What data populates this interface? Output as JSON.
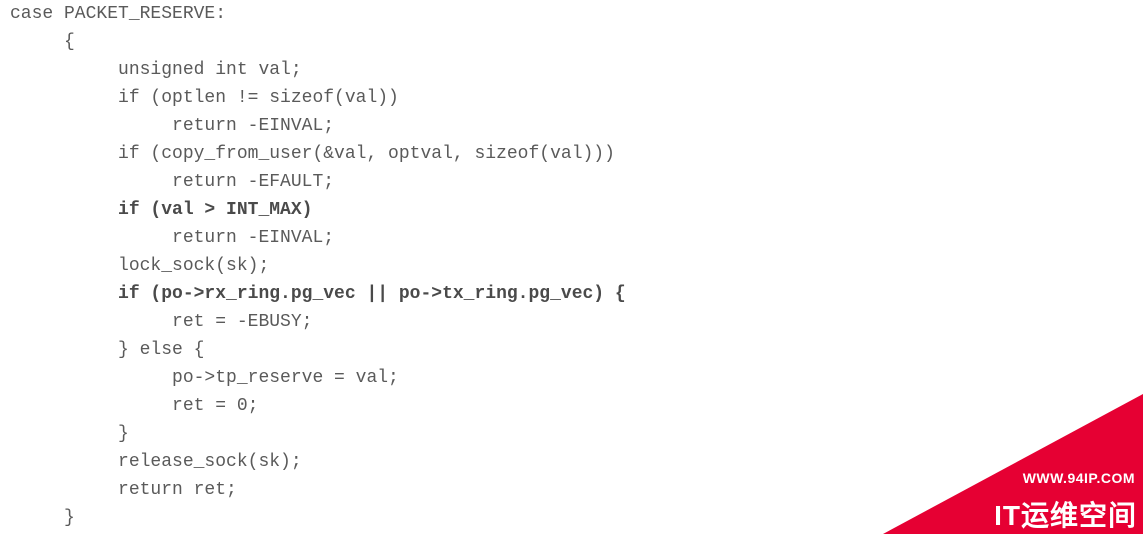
{
  "code": {
    "lines": [
      {
        "indent": 0,
        "text": "case PACKET_RESERVE:",
        "bold": false
      },
      {
        "indent": 1,
        "text": "{",
        "bold": false
      },
      {
        "indent": 2,
        "text": "unsigned int val;",
        "bold": false
      },
      {
        "indent": 2,
        "text": "if (optlen != sizeof(val))",
        "bold": false
      },
      {
        "indent": 3,
        "text": "return -EINVAL;",
        "bold": false
      },
      {
        "indent": 2,
        "text": "if (copy_from_user(&val, optval, sizeof(val)))",
        "bold": false
      },
      {
        "indent": 3,
        "text": "return -EFAULT;",
        "bold": false
      },
      {
        "indent": 2,
        "text": "if (val > INT_MAX)",
        "bold": true
      },
      {
        "indent": 3,
        "text": "return -EINVAL;",
        "bold": false
      },
      {
        "indent": 2,
        "text": "lock_sock(sk);",
        "bold": false
      },
      {
        "indent": 2,
        "text": "if (po->rx_ring.pg_vec || po->tx_ring.pg_vec) {",
        "bold": true
      },
      {
        "indent": 3,
        "text": "ret = -EBUSY;",
        "bold": false
      },
      {
        "indent": 2,
        "text": "} else {",
        "bold": false
      },
      {
        "indent": 3,
        "text": "po->tp_reserve = val;",
        "bold": false
      },
      {
        "indent": 3,
        "text": "ret = 0;",
        "bold": false
      },
      {
        "indent": 2,
        "text": "}",
        "bold": false
      },
      {
        "indent": 2,
        "text": "release_sock(sk);",
        "bold": false
      },
      {
        "indent": 2,
        "text": "return ret;",
        "bold": false
      },
      {
        "indent": 1,
        "text": "}",
        "bold": false
      }
    ],
    "indent_unit": "     "
  },
  "watermark": {
    "url": "WWW.94IP.COM",
    "title": "IT运维空间"
  }
}
